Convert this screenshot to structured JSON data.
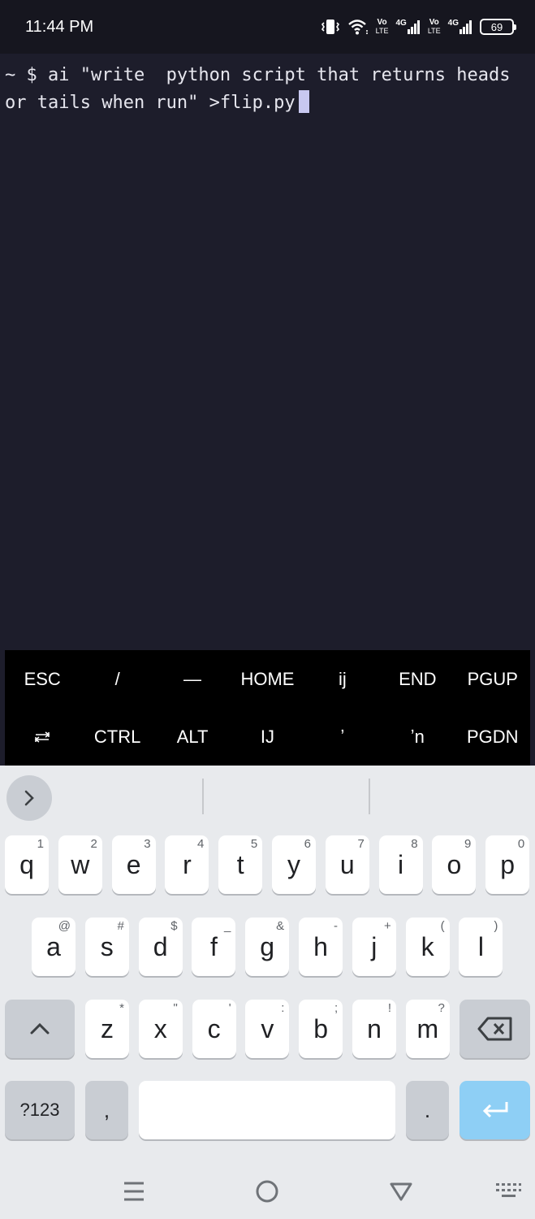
{
  "status_bar": {
    "time": "11:44 PM",
    "battery": "69",
    "icons": [
      "vibrate-icon",
      "wifi-icon",
      "volte-icon",
      "signal-4g-icon",
      "volte-icon",
      "signal-4g-icon",
      "battery-icon"
    ],
    "net1_top": "Vo",
    "net1_bottom": "LTE",
    "net1_gen": "4G",
    "net2_top": "Vo",
    "net2_bottom": "LTE",
    "net2_gen": "4G"
  },
  "terminal": {
    "prompt_line": "~ $ ai \"write  python script that returns heads or tails when run\" >flip.py"
  },
  "extra_keys": {
    "row1": [
      "ESC",
      "/",
      "—",
      "HOME",
      "ij",
      "END",
      "PGUP"
    ],
    "row2": [
      "⭾",
      "CTRL",
      "ALT",
      "IJ",
      "ʼ",
      "ʼn",
      "PGDN"
    ]
  },
  "keyboard": {
    "row1": [
      {
        "key": "q",
        "hint": "1"
      },
      {
        "key": "w",
        "hint": "2"
      },
      {
        "key": "e",
        "hint": "3"
      },
      {
        "key": "r",
        "hint": "4"
      },
      {
        "key": "t",
        "hint": "5"
      },
      {
        "key": "y",
        "hint": "6"
      },
      {
        "key": "u",
        "hint": "7"
      },
      {
        "key": "i",
        "hint": "8"
      },
      {
        "key": "o",
        "hint": "9"
      },
      {
        "key": "p",
        "hint": "0"
      }
    ],
    "row2": [
      {
        "key": "a",
        "hint": "@"
      },
      {
        "key": "s",
        "hint": "#"
      },
      {
        "key": "d",
        "hint": "$"
      },
      {
        "key": "f",
        "hint": "_"
      },
      {
        "key": "g",
        "hint": "&"
      },
      {
        "key": "h",
        "hint": "-"
      },
      {
        "key": "j",
        "hint": "+"
      },
      {
        "key": "k",
        "hint": "("
      },
      {
        "key": "l",
        "hint": ")"
      }
    ],
    "row3": [
      {
        "key": "z",
        "hint": "*"
      },
      {
        "key": "x",
        "hint": "\""
      },
      {
        "key": "c",
        "hint": "'"
      },
      {
        "key": "v",
        "hint": ":"
      },
      {
        "key": "b",
        "hint": ";"
      },
      {
        "key": "n",
        "hint": "!"
      },
      {
        "key": "m",
        "hint": "?"
      }
    ],
    "symbols_label": "?123",
    "comma_label": ",",
    "period_label": ".",
    "enter_color": "#8ecff5"
  },
  "colors": {
    "terminal_bg": "#1d1d2b",
    "extra_keys_bg": "#000000",
    "keyboard_bg": "#e8eaed"
  }
}
